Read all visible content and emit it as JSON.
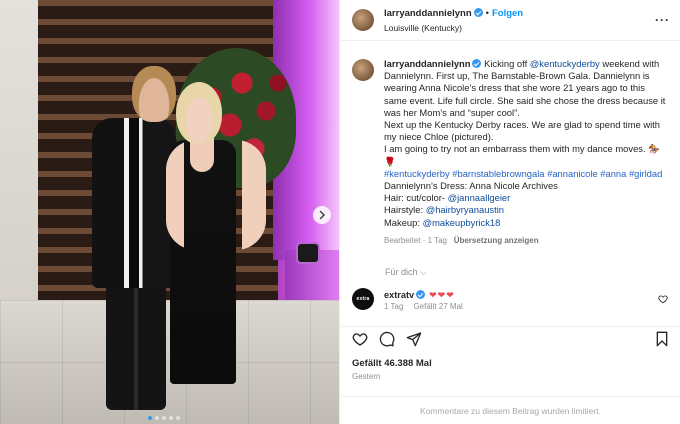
{
  "post": {
    "username": "larryanddannielynn",
    "follow_label": "Folgen",
    "location": "Louisville (Kentucky)",
    "more_icon": "more-horizontal-icon"
  },
  "caption": {
    "username": "larryanddannielynn",
    "line1_a": "Kicking off ",
    "line1_mention": "@kentuckyderby",
    "line1_b": " weekend with Dannielynn. First up, The Barnstable-Brown Gala. Dannielynn is wearing Anna Nicole’s dress that she wore 21 years ago to this same event. Life full circle. She said she chose the dress because it was her Mom’s and “super cool”.",
    "line2": "Next up the Kentucky Derby races. We are glad to spend time with my niece Chloe (pictured).",
    "line3": "I am going to try not an embarrass them with my dance moves. 🏇🌹",
    "hashtags": "#kentuckyderby #barnstablebrowngala #annanicole #anna #girldad",
    "dress": "Dannielynn’s Dress: Anna Nicole Archives",
    "hair_label": "Hair: cut/color- ",
    "hair_mention": "@jannaallgeier",
    "hairstyle_label": "Hairstyle: ",
    "hairstyle_mention": "@hairbyryanaustin",
    "makeup_label": "Makeup: ",
    "makeup_mention": "@makeupbyrick18",
    "edited": "Bearbeitet · 1 Tag",
    "translate": "Übersetzung anzeigen"
  },
  "for_you": "Für dich ⌵",
  "comment": {
    "avatar_text": "extra",
    "username": "extratv",
    "text": "❤❤❤",
    "time": "1 Tag",
    "liked_by": "Gefällt 27 Mal"
  },
  "actions": {
    "like_icon": "heart-icon",
    "comment_icon": "comment-icon",
    "share_icon": "send-icon",
    "save_icon": "bookmark-icon"
  },
  "likes": "Gefällt 46.388 Mal",
  "date": "Gestern",
  "footer": "Kommentare zu diesem Beitrag wurden limitiert.",
  "carousel": {
    "total_dots": 5,
    "active_index": 0
  },
  "colors": {
    "link": "#0f4c9b",
    "hashtag": "#2563c8",
    "follow": "#0095f6",
    "heart": "#ed4956"
  }
}
